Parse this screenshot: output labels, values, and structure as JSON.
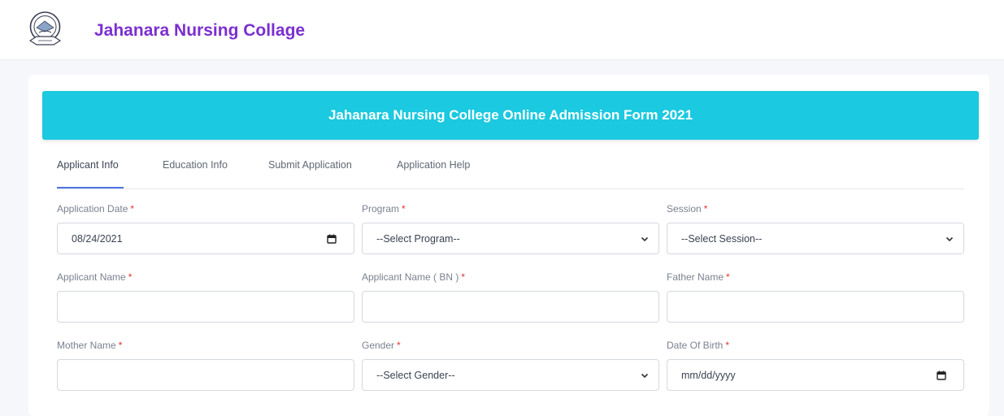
{
  "header": {
    "brand": "Jahanara Nursing Collage",
    "logo_icon": "college-emblem-icon"
  },
  "form": {
    "banner_title": "Jahanara Nursing College Online Admission Form 2021",
    "tabs": [
      {
        "label": "Applicant Info",
        "active": true
      },
      {
        "label": "Education Info"
      },
      {
        "label": "Submit Application"
      },
      {
        "label": "Application Help"
      }
    ],
    "required_mark": "*",
    "fields": {
      "application_date": {
        "label": "Application Date",
        "value": "08/24/2021"
      },
      "program": {
        "label": "Program",
        "selected": "--Select Program--"
      },
      "session": {
        "label": "Session",
        "selected": "--Select Session--"
      },
      "applicant_name": {
        "label": "Applicant Name",
        "value": ""
      },
      "applicant_name_bn": {
        "label": "Applicant Name ( BN )",
        "value": ""
      },
      "father_name": {
        "label": "Father Name",
        "value": ""
      },
      "mother_name": {
        "label": "Mother Name",
        "value": ""
      },
      "gender": {
        "label": "Gender",
        "selected": "--Select Gender--"
      },
      "date_of_birth": {
        "label": "Date Of Birth",
        "placeholder": "mm/dd/yyyy"
      }
    }
  },
  "colors": {
    "brand": "#7b2fd0",
    "banner": "#1bc9e0",
    "active_tab": "#4e73df",
    "required": "#e3342f"
  }
}
